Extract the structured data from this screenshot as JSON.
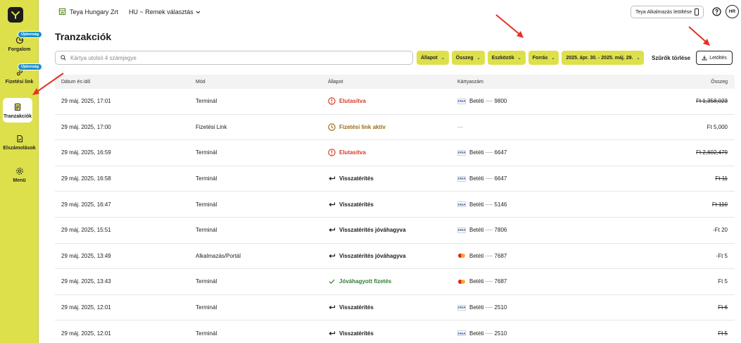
{
  "sidebar": {
    "items": [
      {
        "label": "Forgalom",
        "badge": "Újdonság",
        "icon": "chart-icon"
      },
      {
        "label": "Fizetési link",
        "badge": "Újdonság",
        "icon": "link-icon"
      },
      {
        "label": "Tranzakciók",
        "badge": "",
        "icon": "receipt-icon"
      },
      {
        "label": "Elszámolások",
        "badge": "",
        "icon": "document-icon"
      },
      {
        "label": "Menü",
        "badge": "",
        "icon": "gear-icon"
      }
    ]
  },
  "header": {
    "merchant": "Teya Hungary Zrt",
    "location": "HU ~ Remek választás",
    "app_download": "Teya Alkalmazás letöltése",
    "avatar": "HR"
  },
  "page": {
    "title": "Tranzakciók",
    "search_placeholder": "Kártya utolsó 4 számjegye",
    "filters": [
      "Állapot",
      "Összeg",
      "Eszközök",
      "Forrás",
      "2025. ápr. 30. - 2025. máj. 29."
    ],
    "clear_filters": "Szűrők törlése",
    "download": "Letöltés"
  },
  "table": {
    "columns": [
      "Dátum és idő",
      "Mód",
      "Állapot",
      "Kártyaszám",
      "Összeg"
    ],
    "rows": [
      {
        "date": "29 máj. 2025, 17:01",
        "mode": "Terminál",
        "status": "Elutasítva",
        "status_type": "declined",
        "card_brand": "visa",
        "card": "Betéti ···· 9800",
        "amount": "Ft 1,358,023",
        "strike": true
      },
      {
        "date": "29 máj. 2025, 17:00",
        "mode": "Fizetési Link",
        "status": "Fizetési link aktív",
        "status_type": "link",
        "card_brand": "",
        "card": "—",
        "amount": "Ft 5,000",
        "strike": false
      },
      {
        "date": "29 máj. 2025, 16:59",
        "mode": "Terminál",
        "status": "Elutasítva",
        "status_type": "declined",
        "card_brand": "visa",
        "card": "Betéti ···· 6647",
        "amount": "Ft 2,602,479",
        "strike": true
      },
      {
        "date": "29 máj. 2025, 16:58",
        "mode": "Terminál",
        "status": "Visszatérítés",
        "status_type": "refund",
        "card_brand": "visa",
        "card": "Betéti ···· 6647",
        "amount": "Ft 11",
        "strike": true
      },
      {
        "date": "29 máj. 2025, 16:47",
        "mode": "Terminál",
        "status": "Visszatérítés",
        "status_type": "refund",
        "card_brand": "visa",
        "card": "Betéti ···· 5146",
        "amount": "Ft 110",
        "strike": true
      },
      {
        "date": "29 máj. 2025, 15:51",
        "mode": "Terminál",
        "status": "Visszatérítés jóváhagyva",
        "status_type": "refund",
        "card_brand": "visa",
        "card": "Betéti ···· 7806",
        "amount": "-Ft 20",
        "strike": false
      },
      {
        "date": "29 máj. 2025, 13:49",
        "mode": "Alkalmazás/Portál",
        "status": "Visszatérítés jóváhagyva",
        "status_type": "refund",
        "card_brand": "mastercard",
        "card": "Betéti ···· 7687",
        "amount": "-Ft 5",
        "strike": false
      },
      {
        "date": "29 máj. 2025, 13:43",
        "mode": "Terminál",
        "status": "Jóváhagyott fizetés",
        "status_type": "approved",
        "card_brand": "mastercard",
        "card": "Betéti ···· 7687",
        "amount": "Ft 5",
        "strike": false
      },
      {
        "date": "29 máj. 2025, 12:01",
        "mode": "Terminál",
        "status": "Visszatérítés",
        "status_type": "refund",
        "card_brand": "visa",
        "card": "Betéti ···· 2510",
        "amount": "Ft 6",
        "strike": true
      },
      {
        "date": "29 máj. 2025, 12:01",
        "mode": "Terminál",
        "status": "Visszatérítés",
        "status_type": "refund",
        "card_brand": "visa",
        "card": "Betéti ···· 2510",
        "amount": "Ft 5",
        "strike": true
      }
    ]
  },
  "colors": {
    "brand": "#dde04a",
    "declined": "#d63a25",
    "link_active": "#9a6a10",
    "approved": "#2e7d32",
    "badge": "#1c8fc4",
    "annotation": "#e53124"
  }
}
